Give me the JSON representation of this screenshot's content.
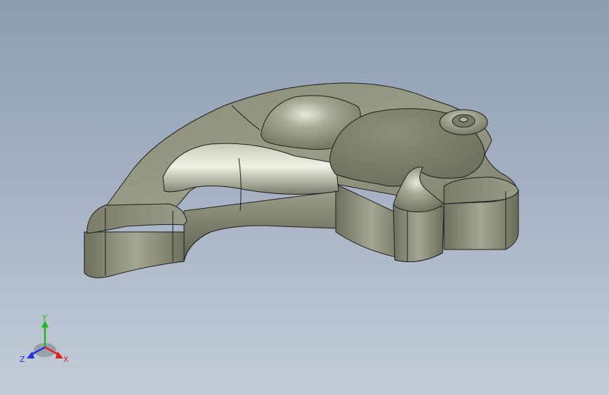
{
  "viewport": {
    "background_top": "#8e9db2",
    "background_bottom": "#c4ccd8",
    "model_color": "#8b8c78",
    "edge_color": "#1e1e1a"
  },
  "triad": {
    "x_label": "X",
    "y_label": "Y",
    "z_label": "Z",
    "x_color": "#e0201a",
    "y_color": "#1fb81f",
    "z_color": "#2233dd"
  }
}
